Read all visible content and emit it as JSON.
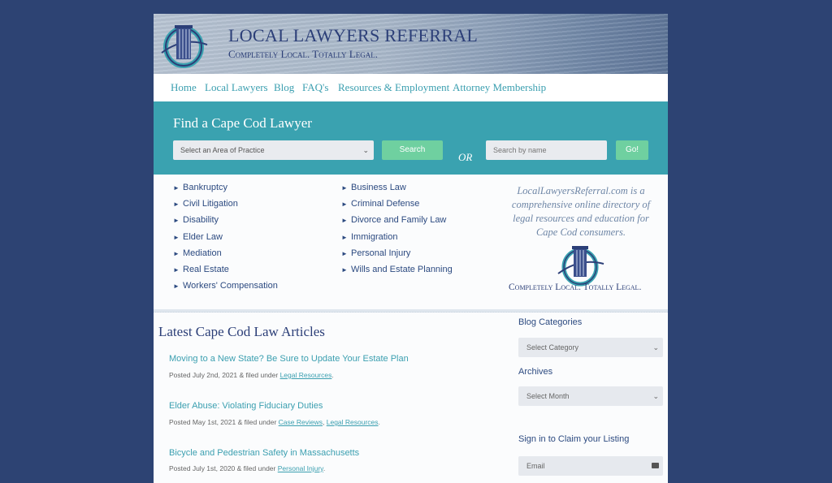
{
  "header": {
    "title": "LOCAL LAWYERS REFERRAL",
    "tagline": "Completely Local. Totally Legal."
  },
  "nav": {
    "items": [
      {
        "label": "Home"
      },
      {
        "label": "Local Lawyers"
      },
      {
        "label": "Blog"
      },
      {
        "label": "FAQ's"
      },
      {
        "label": "Resources & Employment"
      },
      {
        "label": "Attorney Membership"
      }
    ]
  },
  "search": {
    "title": "Find a Cape Cod Lawyer",
    "practice_select": "Select an Area of Practice",
    "search_button": "Search",
    "or_label": "OR",
    "name_placeholder": "Search by name",
    "go_button": "Go!"
  },
  "practice_areas": {
    "column1": [
      "Bankruptcy",
      "Civil Litigation",
      "Disability",
      "Elder Law",
      "Mediation",
      "Real Estate",
      "Workers' Compensation"
    ],
    "column2": [
      "Business Law",
      "Criminal Defense",
      "Divorce and Family Law",
      "Immigration",
      "Personal Injury",
      "Wills and Estate Planning"
    ],
    "bullet_icon": "triangle-right"
  },
  "about": {
    "text": "LocalLawyersReferral.com is a comprehensive online directory of legal resources and education for Cape Cod consumers.",
    "tagline": "Completely Local. Totally Legal."
  },
  "articles": {
    "heading": "Latest Cape Cod Law Articles",
    "items": [
      {
        "title": "Moving to a New State? Be Sure to Update Your Estate Plan",
        "meta_prefix": "Posted July 2nd, 2021 & filed under ",
        "categories": [
          "Legal Resources"
        ]
      },
      {
        "title": "Elder Abuse: Violating Fiduciary Duties",
        "meta_prefix": "Posted May 1st, 2021 & filed under ",
        "categories": [
          "Case Reviews",
          "Legal Resources"
        ]
      },
      {
        "title": "Bicycle and Pedestrian Safety in Massachusetts",
        "meta_prefix": "Posted July 1st, 2020 & filed under ",
        "categories": [
          "Personal Injury"
        ]
      }
    ]
  },
  "sidebar": {
    "blog_categories_heading": "Blog Categories",
    "category_select": "Select Category",
    "archives_heading": "Archives",
    "month_select": "Select Month",
    "signin_heading": "Sign in to Claim your Listing",
    "email_placeholder": "Email"
  },
  "colors": {
    "background": "#2d4373",
    "teal": "#3aa2b0",
    "green_button": "#6fd0a0",
    "navy_text": "#2c3f78",
    "link": "#3b9fb0"
  }
}
